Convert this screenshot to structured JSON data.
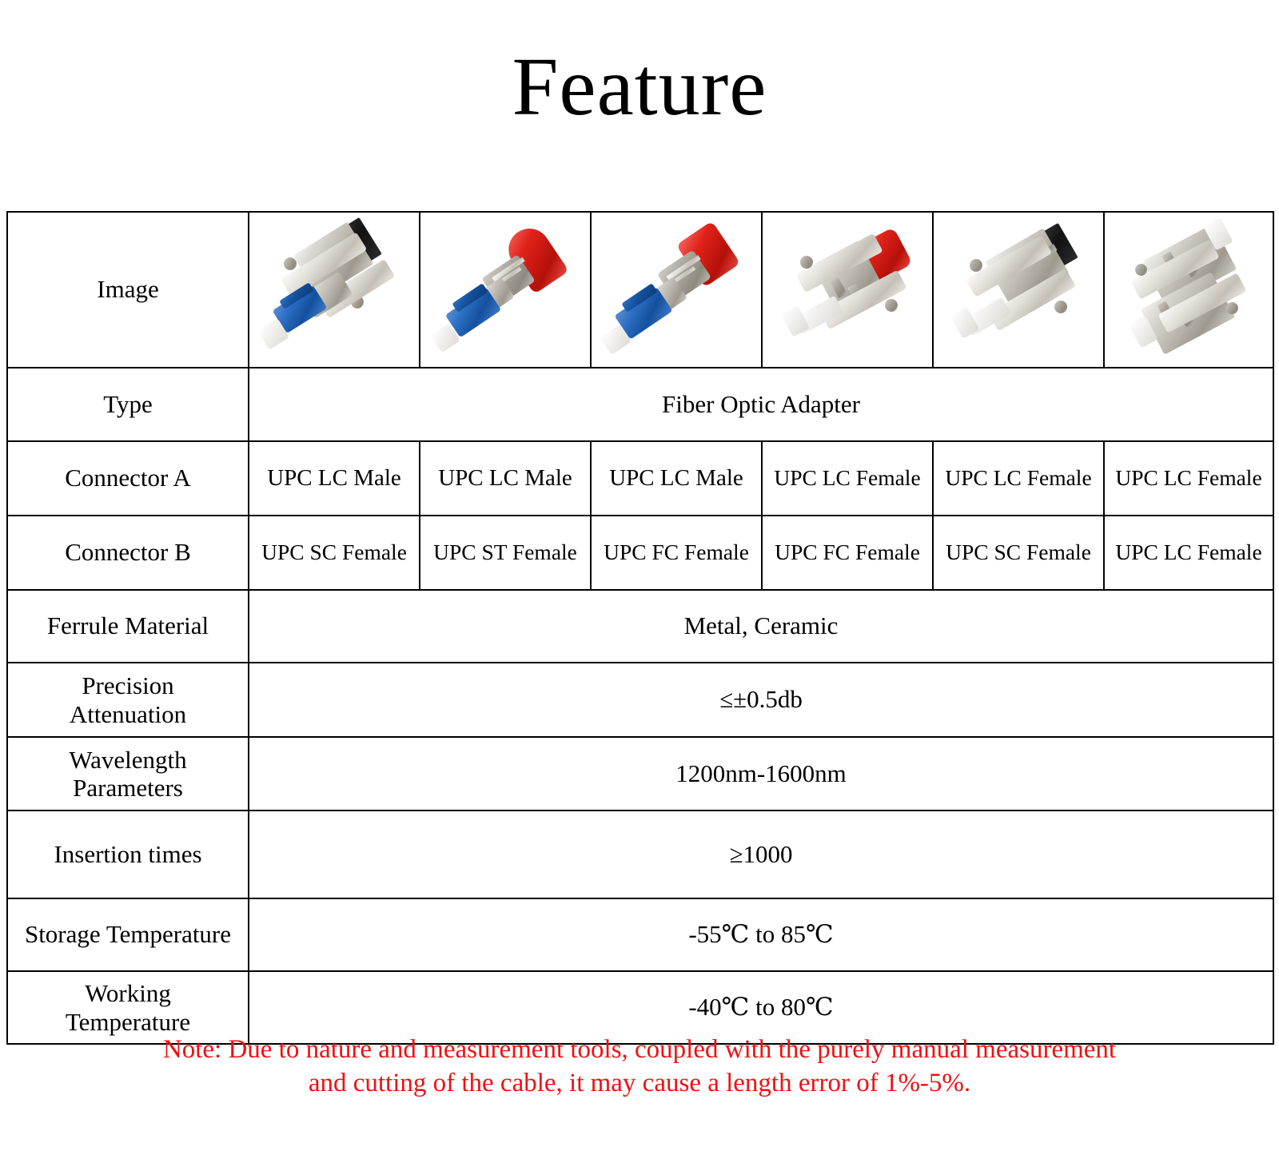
{
  "title": "Feature",
  "table": {
    "rows": {
      "image_label": "Image",
      "type_label": "Type",
      "type_value": "Fiber Optic Adapter",
      "connector_a_label": "Connector A",
      "connector_b_label": "Connector B",
      "ferrule_label": "Ferrule Material",
      "ferrule_value": "Metal, Ceramic",
      "precision_label_line1": "Precision",
      "precision_label_line2": "Attenuation",
      "precision_value": "≤±0.5db",
      "wavelength_label_line1": "Wavelength",
      "wavelength_label_line2": "Parameters",
      "wavelength_value": "1200nm-1600nm",
      "insertion_label": "Insertion times",
      "insertion_value": "≥1000",
      "storage_label": "Storage Temperature",
      "storage_value": "-55℃ to 85℃",
      "working_label_line1": "Working",
      "working_label_line2": "Temperature",
      "working_value": "-40℃ to 80℃"
    },
    "products": [
      {
        "image_name": "lc-male-to-sc-female-adapter-photo",
        "connector_a": "UPC LC Male",
        "connector_b": "UPC SC Female"
      },
      {
        "image_name": "lc-male-to-st-female-adapter-photo",
        "connector_a": "UPC LC Male",
        "connector_b": "UPC ST Female"
      },
      {
        "image_name": "lc-male-to-fc-female-adapter-photo",
        "connector_a": "UPC LC Male",
        "connector_b": "UPC FC Female"
      },
      {
        "image_name": "lc-female-to-fc-female-adapter-photo",
        "connector_a": "UPC LC Female",
        "connector_b": "UPC FC Female"
      },
      {
        "image_name": "lc-female-to-sc-female-adapter-photo",
        "connector_a": "UPC LC Female",
        "connector_b": "UPC SC Female"
      },
      {
        "image_name": "lc-female-to-lc-female-adapter-photo",
        "connector_a": "UPC LC Female",
        "connector_b": "UPC LC Female"
      }
    ]
  },
  "note": {
    "line1": "Note: Due to nature and measurement tools, coupled with the purely manual measurement",
    "line2": "and cutting of the cable, it may cause a length error of 1%-5%."
  },
  "colors": {
    "note_red": "#ee1111",
    "text_black": "#000000",
    "background": "#ffffff",
    "connector_blue": "#14509e",
    "dust_cap_red": "#e02219",
    "metal_body": "#b9b5ac"
  }
}
